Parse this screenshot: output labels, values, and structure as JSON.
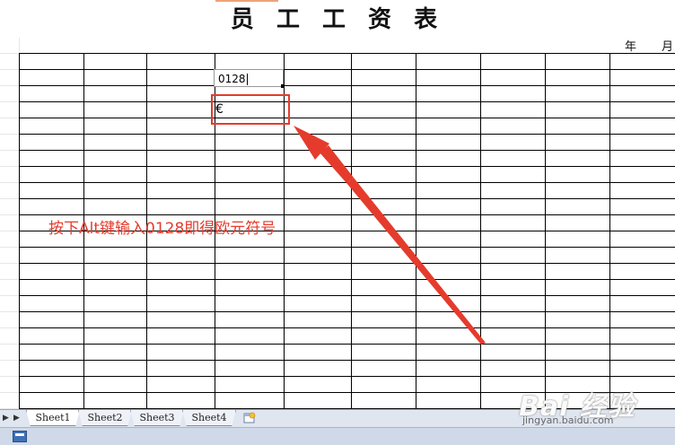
{
  "sheet": {
    "title": "员 工 工 资 表",
    "year_label": "年",
    "month_label": "月",
    "active_cell_value": "0128",
    "result_cell_value": "€",
    "rows": 22,
    "cols": 10
  },
  "annotation": {
    "text": "按下Alt键输入0128即得欧元符号",
    "color": "#e53b2c"
  },
  "tabs": {
    "items": [
      {
        "label": "Sheet1",
        "active": true
      },
      {
        "label": "Sheet2",
        "active": false
      },
      {
        "label": "Sheet3",
        "active": false
      },
      {
        "label": "Sheet4",
        "active": false
      }
    ],
    "new_sheet_icon": "new-sheet-icon",
    "nav_first_icon": "nav-first-icon",
    "nav_prev_icon": "nav-prev-icon"
  },
  "watermark": {
    "brand": "Bai 经验",
    "url": "jingyan.baidu.com"
  },
  "colors": {
    "accent_red": "#e53b2c",
    "tab_bar": "#dfe6f0",
    "status_bar": "#cfd9e8"
  }
}
